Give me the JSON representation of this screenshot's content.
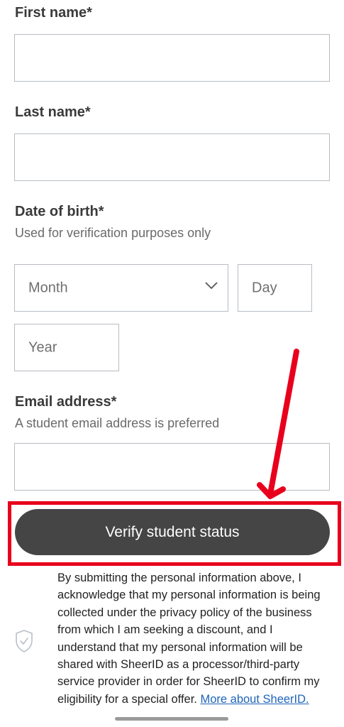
{
  "form": {
    "first_name_label": "First name*",
    "last_name_label": "Last name*",
    "dob_label": "Date of birth*",
    "dob_hint": "Used for verification purposes only",
    "month_placeholder": "Month",
    "day_placeholder": "Day",
    "year_placeholder": "Year",
    "email_label": "Email address*",
    "email_hint": "A student email address is preferred",
    "submit_label": "Verify student status"
  },
  "consent": {
    "text": "By submitting the personal information above, I acknowledge that my personal information is being collected under the privacy policy of the business from which I am seeking a discount, and I understand that my personal information will be shared with SheerID as a processor/third-party service provider in order for SheerID to confirm my eligibility for a special offer. ",
    "link_label": "More about SheerID."
  },
  "colors": {
    "annotation": "#e8001c",
    "button_bg": "#454545",
    "link": "#1f64b8"
  },
  "icons": [
    "chevron-down-icon",
    "shield-check-icon"
  ]
}
